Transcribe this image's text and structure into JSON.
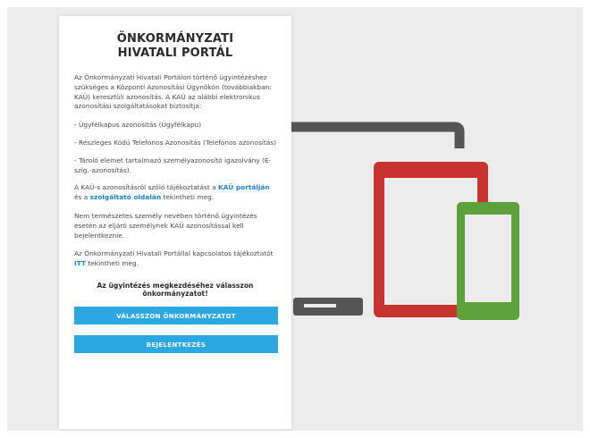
{
  "portal": {
    "title_line1": "ÖNKORMÁNYZATI",
    "title_line2": "HIVATALI PORTÁL",
    "intro": "Az Önkormányzati Hivatali Portálon történő ügyintézéshez szükséges a Központi Azonosítási Ügynökön (továbbiakban: KAÜ) keresztüli azonosítás. A KAÜ az alábbi elektronikus azonosítási szolgáltatásokat biztosítja:",
    "services": [
      "- Ügyfélkapus azonosítás (Ügyfélkapu)",
      "- Részleges Kódú Telefonos Azonosítás (Telefonos azonosítás)",
      "- Tároló elemet tartalmazó személyazonosító igazolvány (E-szig.-azonosítás)."
    ],
    "kau_info": {
      "prefix": "A KAÜ-s azonosításról szóló tájékoztatást a ",
      "link1": "KAÜ portálján",
      "middle": " és a ",
      "link2": "szolgáltató oldalán",
      "suffix": " tekintheti meg."
    },
    "non_natural": "Nem természetes személy nevében történő ügyintézés esetén az eljáró személynek KAÜ azonosítással kell bejelentkeznie.",
    "portal_info": {
      "prefix": "Az Önkormányzati Hivatali Portállal kapcsolatos tájékoztatót ",
      "link": "ITT",
      "suffix": " tekintheti meg."
    },
    "prompt": "Az ügyintézés megkezdéséhez válasszon önkormányzatot!",
    "choose_button": "VÁLASSZON ÖNKORMÁNYZATOT",
    "login_button": "BEJELENTKEZÉS"
  },
  "colors": {
    "background": "#ececec",
    "button": "#2ba7e2",
    "link": "#1d7fd1",
    "laptop": "#555555",
    "tablet": "#c8322f",
    "phone": "#5ca13a"
  },
  "illustration": {
    "devices": [
      "laptop-icon",
      "tablet-icon",
      "phone-icon"
    ]
  }
}
